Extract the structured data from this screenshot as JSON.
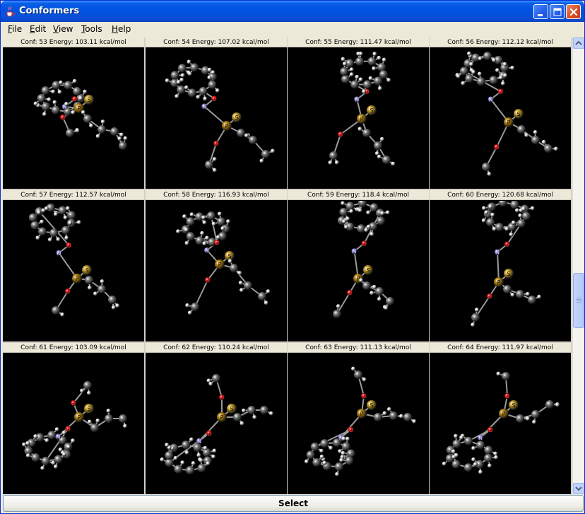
{
  "window": {
    "title": "Conformers",
    "icon": "java-cup-icon",
    "controls": [
      "minimize-icon",
      "maximize-icon",
      "close-icon"
    ]
  },
  "menu": [
    {
      "label": "File",
      "mnemonic": "F",
      "rest": "ile"
    },
    {
      "label": "Edit",
      "mnemonic": "E",
      "rest": "dit"
    },
    {
      "label": "View",
      "mnemonic": "V",
      "rest": "iew"
    },
    {
      "label": "Tools",
      "mnemonic": "T",
      "rest": "ools"
    },
    {
      "label": "Help",
      "mnemonic": "H",
      "rest": "elp"
    }
  ],
  "conformers": [
    {
      "conf": "53",
      "energy": "103.11",
      "label": "Conf: 53  Energy: 103.11 kcal/mol"
    },
    {
      "conf": "54",
      "energy": "107.02",
      "label": "Conf: 54  Energy: 107.02 kcal/mol"
    },
    {
      "conf": "55",
      "energy": "111.47",
      "label": "Conf: 55  Energy: 111.47 kcal/mol"
    },
    {
      "conf": "56",
      "energy": "112.12",
      "label": "Conf: 56  Energy: 112.12 kcal/mol"
    },
    {
      "conf": "57",
      "energy": "112.57",
      "label": "Conf: 57  Energy: 112.57 kcal/mol"
    },
    {
      "conf": "58",
      "energy": "116.93",
      "label": "Conf: 58  Energy: 116.93 kcal/mol"
    },
    {
      "conf": "59",
      "energy": "118.4",
      "label": "Conf: 59  Energy: 118.4 kcal/mol"
    },
    {
      "conf": "60",
      "energy": "120.68",
      "label": "Conf: 60  Energy: 120.68 kcal/mol"
    },
    {
      "conf": "61",
      "energy": "103.09",
      "label": "Conf: 61  Energy: 103.09 kcal/mol"
    },
    {
      "conf": "62",
      "energy": "110.24",
      "label": "Conf: 62  Energy: 110.24 kcal/mol"
    },
    {
      "conf": "63",
      "energy": "111.13",
      "label": "Conf: 63  Energy: 111.13 kcal/mol"
    },
    {
      "conf": "64",
      "energy": "111.97",
      "label": "Conf: 64  Energy: 111.97 kcal/mol"
    }
  ],
  "atom_labels": {
    "phosphorus": "P",
    "sulfur": "S",
    "oxygen": "O",
    "nitrogen": "N"
  },
  "colors": {
    "carbon": "#7a7a7a",
    "hydrogen": "#e6e6e6",
    "phosphorus": "#b8860b",
    "sulfur": "#c9a227",
    "oxygen": "#d01010",
    "nitrogen": "#8a8ad8",
    "viewport_bg": "#000000"
  },
  "footer": {
    "select_label": "Select"
  },
  "scroll": {
    "position_fraction": 0.52
  }
}
